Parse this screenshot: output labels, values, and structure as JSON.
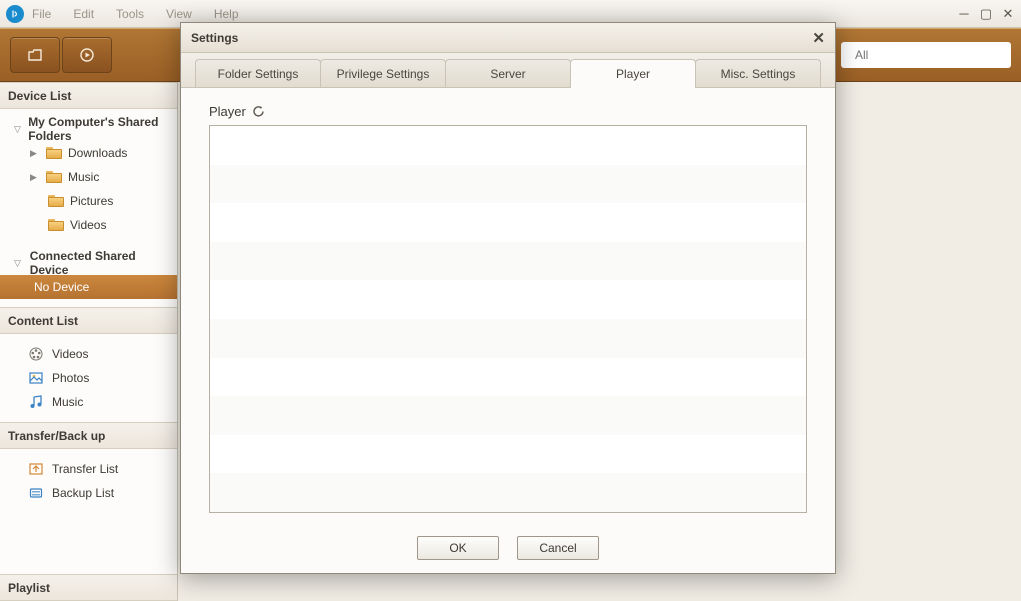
{
  "menu": {
    "file": "File",
    "edit": "Edit",
    "tools": "Tools",
    "view": "View",
    "help": "Help"
  },
  "search": {
    "placeholder": "All"
  },
  "sidebar": {
    "device_list_header": "Device List",
    "shared_folders_header": "My Computer's Shared Folders",
    "connected_header": "Connected Shared Device",
    "content_list_header": "Content List",
    "transfer_header": "Transfer/Back up",
    "playlist_header": "Playlist",
    "folders": {
      "downloads": "Downloads",
      "music": "Music",
      "pictures": "Pictures",
      "videos": "Videos"
    },
    "no_device": "No Device",
    "content": {
      "videos": "Videos",
      "photos": "Photos",
      "music": "Music"
    },
    "transfer": {
      "transfer_list": "Transfer List",
      "backup_list": "Backup List"
    }
  },
  "dialog": {
    "title": "Settings",
    "tabs": {
      "folder": "Folder Settings",
      "privilege": "Privilege Settings",
      "server": "Server",
      "player": "Player",
      "misc": "Misc. Settings"
    },
    "body_label": "Player",
    "ok": "OK",
    "cancel": "Cancel"
  }
}
